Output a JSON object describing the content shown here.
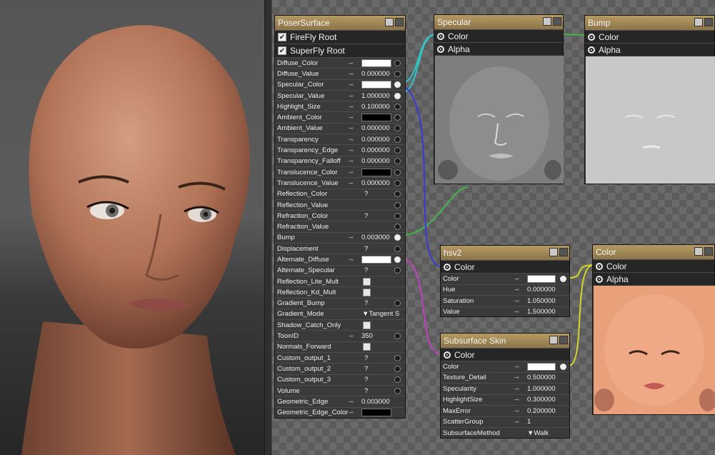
{
  "root_node": {
    "title": "PoserSurface",
    "firefly_root": "FireFly Root",
    "superfly_root": "SuperFly Root",
    "params": [
      {
        "name": "Diffuse_Color",
        "value": "",
        "swatch": "#ffffff",
        "plug": "off"
      },
      {
        "name": "Diffuse_Value",
        "value": "0.000000",
        "plug": "off"
      },
      {
        "name": "Specular_Color",
        "value": "",
        "swatch": "#ffffff",
        "plug": "on"
      },
      {
        "name": "Specular_Value",
        "value": "1.000000",
        "plug": "on"
      },
      {
        "name": "Highlight_Size",
        "value": "0.100000",
        "plug": "off"
      },
      {
        "name": "Ambient_Color",
        "value": "",
        "swatch": "#000000",
        "plug": "off"
      },
      {
        "name": "Ambient_Value",
        "value": "0.000000",
        "plug": "off"
      },
      {
        "name": "Transparency",
        "value": "0.000000",
        "plug": "off"
      },
      {
        "name": "Transparency_Edge",
        "value": "0.000000",
        "plug": "off"
      },
      {
        "name": "Transparency_Falloff",
        "value": "0.000000",
        "plug": "off"
      },
      {
        "name": "Translucence_Color",
        "value": "",
        "swatch": "#000000",
        "plug": "off"
      },
      {
        "name": "Translucence_Value",
        "value": "0.000000",
        "plug": "off"
      },
      {
        "name": "Reflection_Color",
        "value": "?",
        "plug": "off"
      },
      {
        "name": "Reflection_Value",
        "value": "",
        "plug": "off"
      },
      {
        "name": "Refraction_Color",
        "value": "?",
        "plug": "off"
      },
      {
        "name": "Refraction_Value",
        "value": "",
        "plug": "off"
      },
      {
        "name": "Bump",
        "value": "0.003000",
        "plug": "on"
      },
      {
        "name": "Displacement",
        "value": "?",
        "plug": "off"
      },
      {
        "name": "Alternate_Diffuse",
        "value": "",
        "swatch": "#ffffff",
        "plug": "on"
      },
      {
        "name": "Alternate_Specular",
        "value": "?",
        "plug": "off"
      },
      {
        "name": "Reflection_Lite_Mult",
        "value": "",
        "checkbox": true
      },
      {
        "name": "Reflection_Kd_Mult",
        "value": "",
        "checkbox": true
      },
      {
        "name": "Gradient_Bump",
        "value": "?",
        "plug": "off"
      },
      {
        "name": "Gradient_Mode",
        "value": "▼Tangent S"
      },
      {
        "name": "Shadow_Catch_Only",
        "value": "",
        "checkbox": true
      },
      {
        "name": "ToonID",
        "value": "350",
        "plug": "off"
      },
      {
        "name": "Normals_Forward",
        "value": "",
        "checkbox": true
      },
      {
        "name": "Custom_output_1",
        "value": "?",
        "plug": "off"
      },
      {
        "name": "Custom_output_2",
        "value": "?",
        "plug": "off"
      },
      {
        "name": "Custom_output_3",
        "value": "?",
        "plug": "off"
      },
      {
        "name": "Volume",
        "value": "?",
        "plug": "off"
      },
      {
        "name": "Geometric_Edge",
        "value": "0.003000"
      },
      {
        "name": "Geometric_Edge_Color",
        "value": "",
        "swatch": "#000000"
      }
    ]
  },
  "specular_node": {
    "title": "Specular",
    "outputs": [
      "Color",
      "Alpha"
    ]
  },
  "bump_node": {
    "title": "Bump",
    "outputs": [
      "Color",
      "Alpha"
    ]
  },
  "hsv_node": {
    "title": "hsv2",
    "output": "Color",
    "params": [
      {
        "name": "Color",
        "value": "",
        "swatch": "#ffffff",
        "plug": "on"
      },
      {
        "name": "Hue",
        "value": "0.000000"
      },
      {
        "name": "Saturation",
        "value": "1.050000"
      },
      {
        "name": "Value",
        "value": "1.500000"
      }
    ]
  },
  "subsurface_node": {
    "title": "Subsurface Skin",
    "output": "Color",
    "params": [
      {
        "name": "Color",
        "value": "",
        "swatch": "#ffffff",
        "plug": "on"
      },
      {
        "name": "Texture_Detail",
        "value": "0.500000"
      },
      {
        "name": "Specularity",
        "value": "1.000000"
      },
      {
        "name": "HighlightSize",
        "value": "0.300000"
      },
      {
        "name": "MaxError",
        "value": "0.200000"
      },
      {
        "name": "ScatterGroup",
        "value": "1"
      },
      {
        "name": "SubsurfaceMethod",
        "value": "▼Walk"
      }
    ]
  },
  "color_node": {
    "title": "Color",
    "outputs": [
      "Color",
      "Alpha"
    ]
  },
  "colors": {
    "node_header": "#a08655",
    "wire_cyan": "#2fc6c6",
    "wire_green": "#3fb54a",
    "wire_blue": "#3a3ad8",
    "wire_magenta": "#c040c0",
    "wire_yellow": "#d6d62a"
  }
}
